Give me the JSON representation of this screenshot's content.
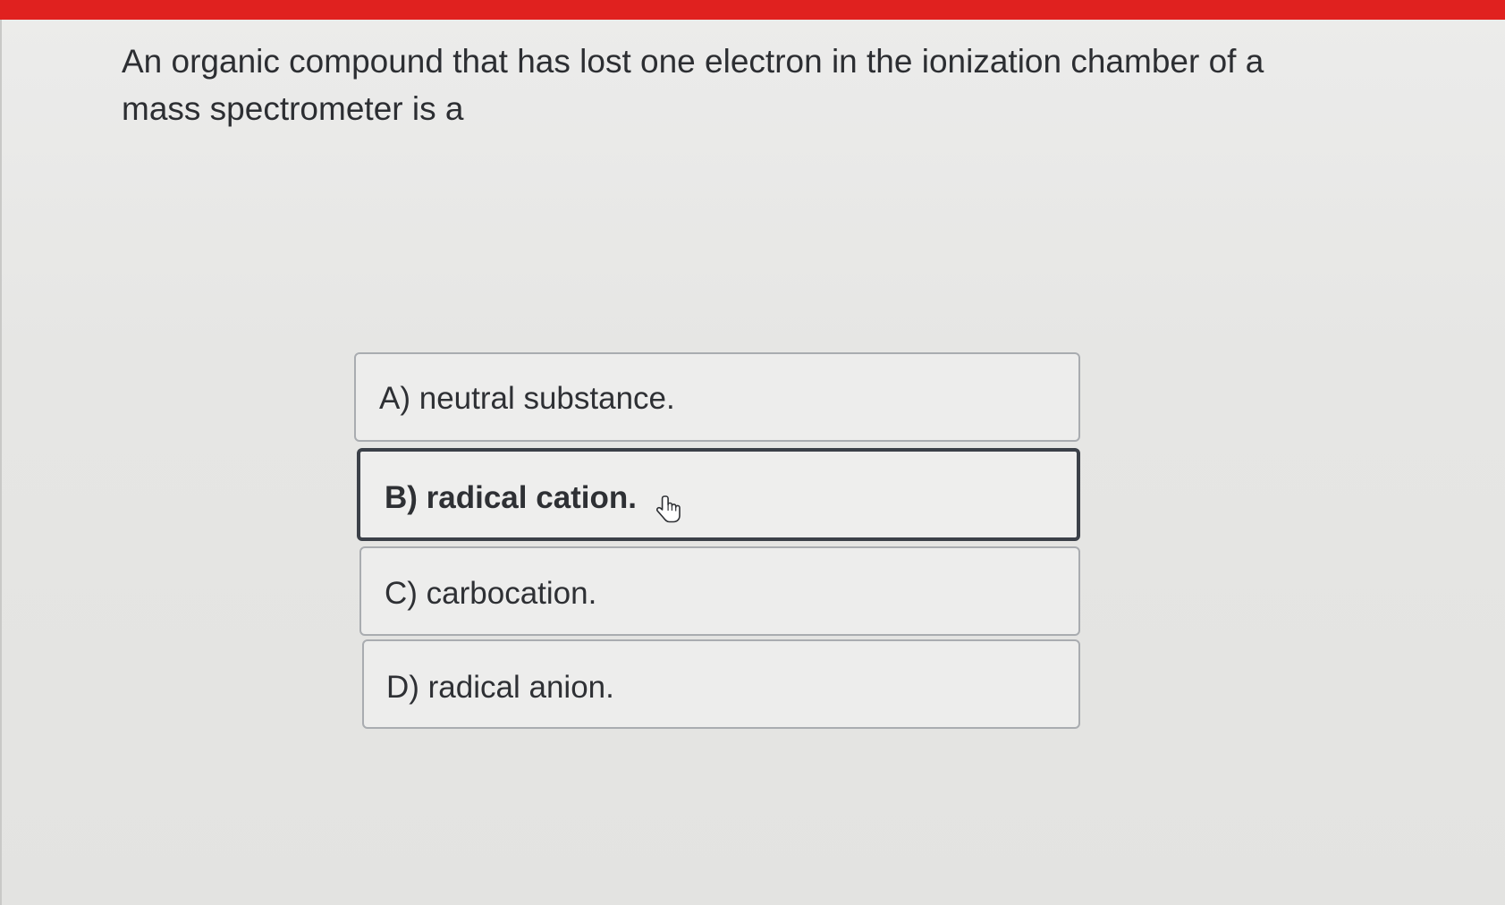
{
  "question": {
    "text": "An organic compound that has lost one electron in the ionization chamber of a mass spectrometer is a"
  },
  "options": [
    {
      "label": "A) neutral substance.",
      "selected": false
    },
    {
      "label": "B) radical cation.",
      "selected": true
    },
    {
      "label": "C) carbocation.",
      "selected": false
    },
    {
      "label": "D) radical anion.",
      "selected": false
    }
  ],
  "colors": {
    "accent_bar": "#e0211f",
    "selected_border": "#3b4048",
    "option_border": "#a9acb0"
  },
  "cursor": {
    "icon": "hand-pointer-icon"
  }
}
